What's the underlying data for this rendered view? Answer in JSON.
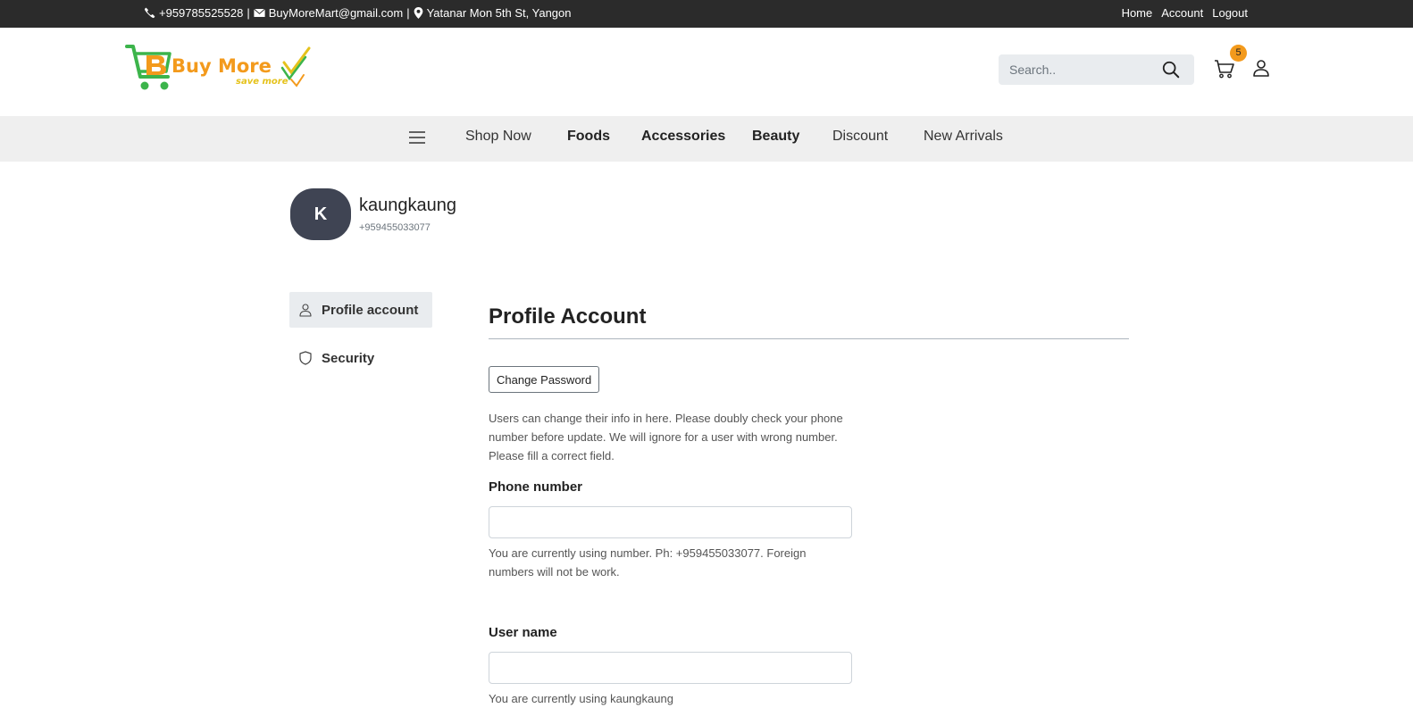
{
  "topbar": {
    "phone": "+959785525528",
    "separator": "|",
    "email": "BuyMoreMart@gmail.com",
    "address": "Yatanar Mon 5th St, Yangon",
    "links": [
      "Home",
      "Account",
      "Logout"
    ]
  },
  "header": {
    "logo_text": "Buy More",
    "logo_tagline": "save more",
    "search_placeholder": "Search..",
    "cart_count": "5"
  },
  "nav": {
    "items": [
      "Shop Now",
      "Foods",
      "Accessories",
      "Beauty",
      "Discount",
      "New Arrivals"
    ]
  },
  "profile": {
    "initial": "K",
    "username": "kaungkaung",
    "phone": "+959455033077"
  },
  "sidebar": {
    "items": [
      {
        "label": "Profile account",
        "icon": "user-icon",
        "active": true
      },
      {
        "label": "Security",
        "icon": "shield-icon",
        "active": false
      }
    ]
  },
  "main": {
    "title": "Profile Account",
    "change_password_label": "Change Password",
    "intro": "Users can change their info in here. Please doubly check your phone number before update. We will ignore for a user with wrong number. Please fill a correct field.",
    "phone_field": {
      "label": "Phone number",
      "value": "",
      "help": "You are currently using number. Ph: +959455033077. Foreign numbers will not be work."
    },
    "username_field": {
      "label": "User name",
      "value": "",
      "help": "You are currently using kaungkaung"
    }
  },
  "colors": {
    "topbar_bg": "#2b2b2b",
    "nav_bg": "#efefef",
    "brand_orange": "#f39a1c",
    "brand_green": "#3cb44b",
    "avatar_bg": "#3f4453"
  }
}
